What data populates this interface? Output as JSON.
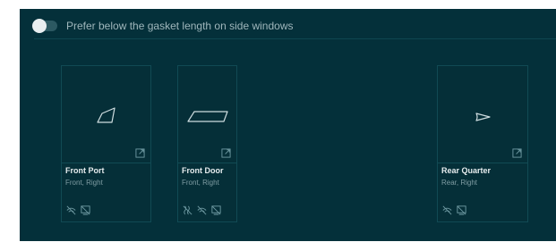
{
  "preference": {
    "label": "Prefer below the gasket length on side windows",
    "enabled": false
  },
  "cards": [
    {
      "title": "Front Port",
      "subtitle": "Front, Right",
      "shape_icon": "front-port-glass-shape-icon",
      "icons": [
        "sensor-off-icon",
        "no-frame-icon"
      ]
    },
    {
      "title": "Front Door",
      "subtitle": "Front, Right",
      "shape_icon": "front-door-glass-shape-icon",
      "icons": [
        "heater-off-icon",
        "sensor-off-icon",
        "no-frame-icon"
      ]
    },
    {
      "title": "Rear Quarter",
      "subtitle": "Rear, Right",
      "shape_icon": "rear-quarter-glass-shape-icon",
      "icons": [
        "sensor-off-icon",
        "no-frame-icon"
      ]
    }
  ],
  "colors": {
    "panel_bg": "#04303a",
    "card_border": "#114a54",
    "text_primary": "#e6ecee",
    "text_secondary": "#7f9da3",
    "icon_stroke": "#6f9aa2"
  }
}
